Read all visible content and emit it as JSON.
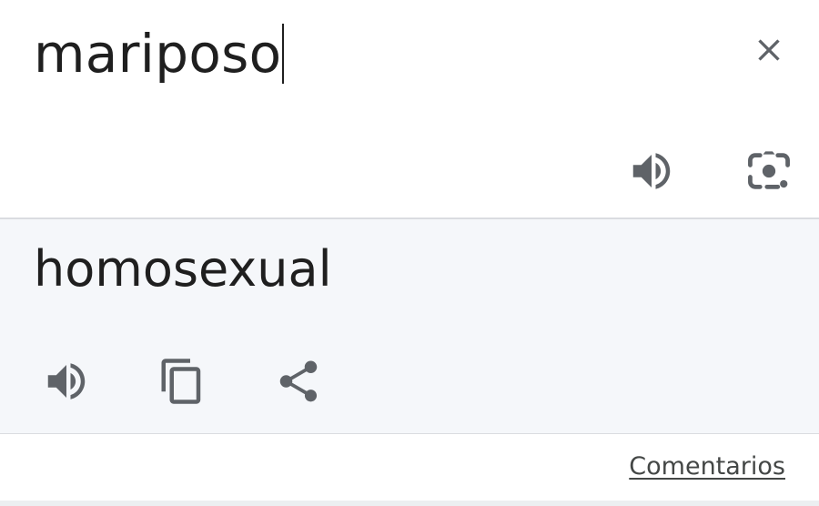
{
  "source": {
    "text": "mariposo",
    "clear_icon": "close-icon",
    "listen_icon": "volume-up-icon",
    "camera_icon": "google-lens-icon"
  },
  "translation": {
    "text": "homosexual",
    "listen_icon": "volume-up-icon",
    "copy_icon": "copy-icon",
    "share_icon": "share-icon"
  },
  "footer": {
    "feedback_label": "Comentarios"
  },
  "colors": {
    "text": "#1f1f1f",
    "icon": "#5f6368",
    "target_bg": "#f5f7fa",
    "divider": "#dadce0",
    "link": "#444746"
  }
}
